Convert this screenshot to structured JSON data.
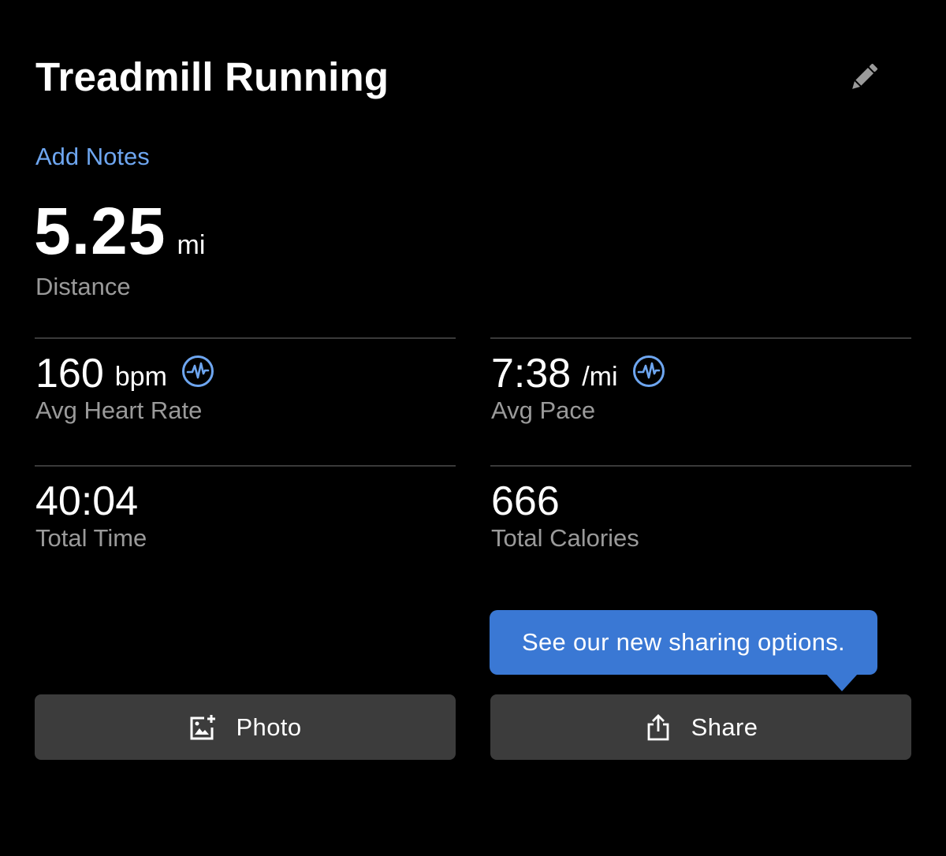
{
  "header": {
    "title": "Treadmill Running",
    "edit_icon": "pencil-icon"
  },
  "notes": {
    "label": "Add Notes",
    "color": "#6ea6f0"
  },
  "distance": {
    "value": "5.25",
    "unit": "mi",
    "label": "Distance"
  },
  "metrics": {
    "heart_rate": {
      "value": "160",
      "unit": "bpm",
      "label": "Avg Heart Rate",
      "icon": "heart-rate-icon"
    },
    "pace": {
      "value": "7:38",
      "unit": "/mi",
      "label": "Avg Pace",
      "icon": "heart-rate-icon"
    },
    "time": {
      "value": "40:04",
      "label": "Total Time"
    },
    "calories": {
      "value": "666",
      "label": "Total Calories"
    }
  },
  "tooltip": {
    "text": "See our new sharing options.",
    "color": "#3a78d4"
  },
  "buttons": {
    "photo": {
      "label": "Photo",
      "icon": "add-photo-icon"
    },
    "share": {
      "label": "Share",
      "icon": "share-icon"
    }
  },
  "colors": {
    "background": "#000000",
    "accent": "#6ea6f0",
    "button_bg": "#3c3c3c",
    "label_gray": "#9a9a9a"
  }
}
